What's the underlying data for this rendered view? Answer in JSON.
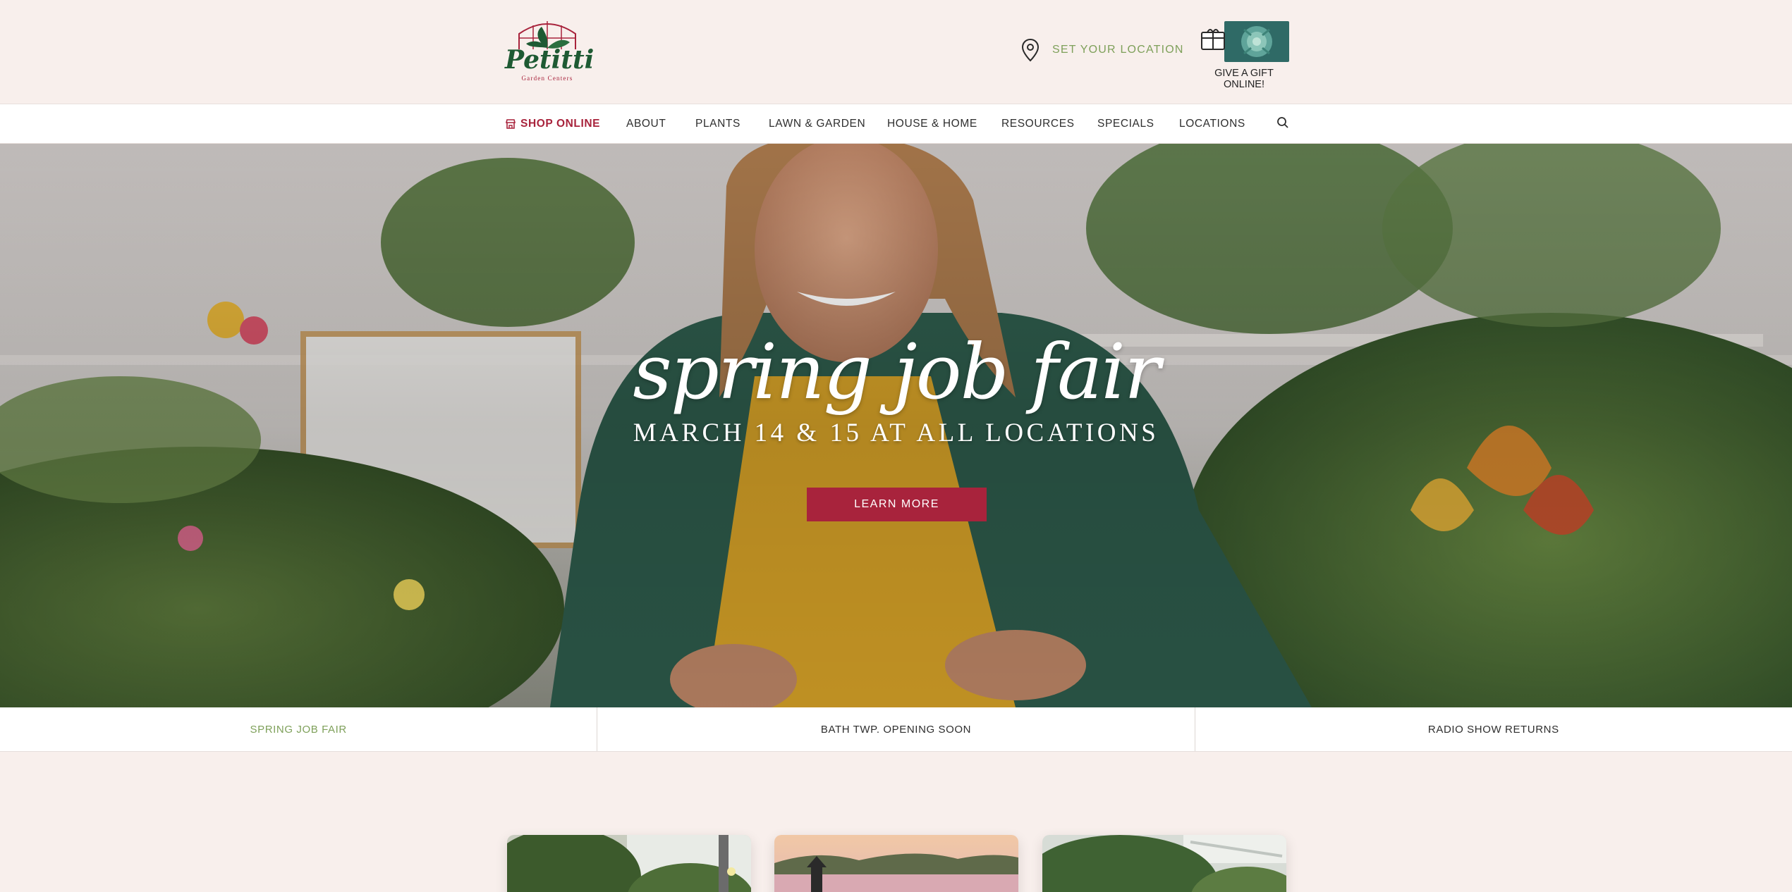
{
  "brand": {
    "name": "Petitti",
    "tagline": "Garden Centers"
  },
  "header": {
    "location_label": "SET YOUR LOCATION",
    "gift_label": "GIVE A GIFT ONLINE!"
  },
  "nav": {
    "shop_online": "SHOP ONLINE",
    "items": [
      "ABOUT",
      "PLANTS",
      "LAWN & GARDEN",
      "HOUSE & HOME",
      "RESOURCES",
      "SPECIALS",
      "LOCATIONS"
    ]
  },
  "hero": {
    "title": "spring job fair",
    "subtitle": "MARCH 14 & 15 AT ALL LOCATIONS",
    "cta": "LEARN MORE"
  },
  "slider_tabs": [
    "SPRING JOB FAIR",
    "BATH TWP. OPENING SOON",
    "RADIO SHOW RETURNS"
  ],
  "colors": {
    "accent": "#a8233c",
    "green": "#7ea05a",
    "background": "#f8efec"
  }
}
